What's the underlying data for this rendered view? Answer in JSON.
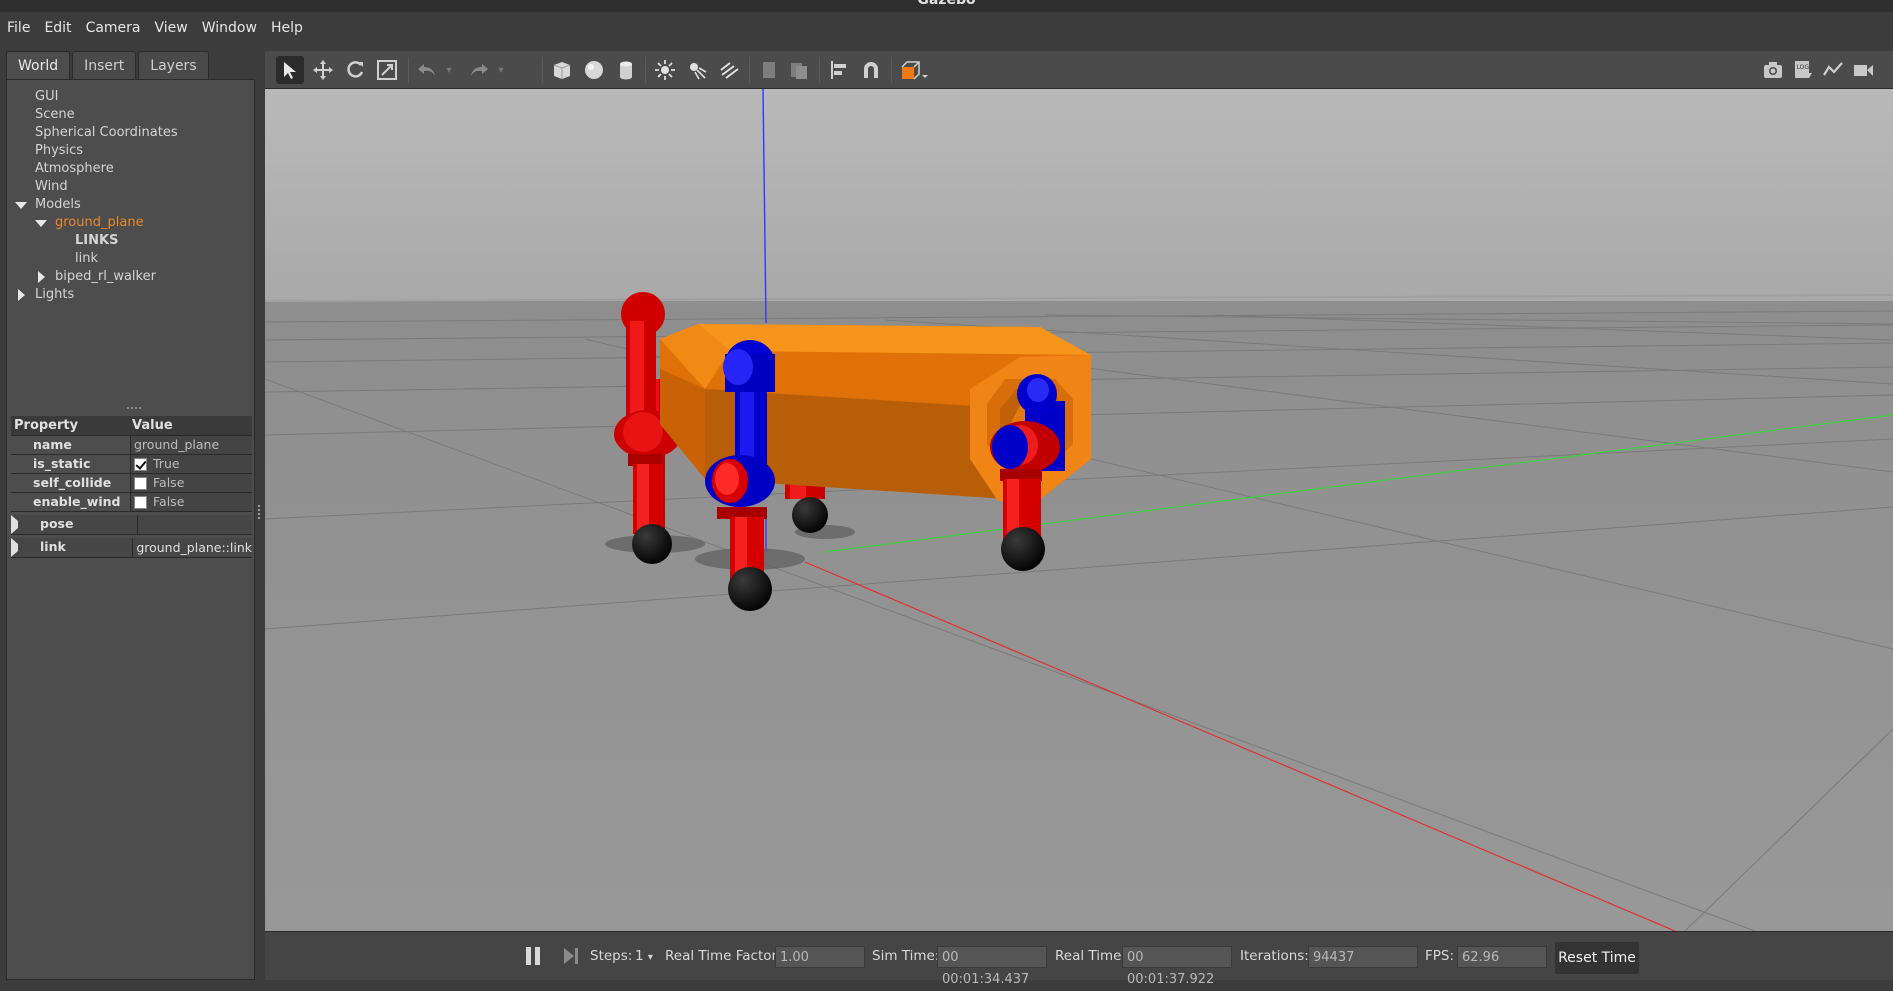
{
  "window": {
    "title": "Gazebo"
  },
  "menu": [
    "File",
    "Edit",
    "Camera",
    "View",
    "Window",
    "Help"
  ],
  "left_panel": {
    "tabs": [
      {
        "label": "World",
        "active": true
      },
      {
        "label": "Insert",
        "active": false
      },
      {
        "label": "Layers",
        "active": false
      }
    ],
    "tree": {
      "gui": "GUI",
      "scene": "Scene",
      "spherical": "Spherical Coordinates",
      "physics": "Physics",
      "atmosphere": "Atmosphere",
      "wind": "Wind",
      "models": "Models",
      "ground_plane": "ground_plane",
      "links_header": "LINKS",
      "link": "link",
      "biped": "biped_rl_walker",
      "lights": "Lights"
    },
    "properties": {
      "header_property": "Property",
      "header_value": "Value",
      "name_label": "name",
      "name_value": "ground_plane",
      "is_static_label": "is_static",
      "is_static_value": "True",
      "self_collide_label": "self_collide",
      "self_collide_value": "False",
      "enable_wind_label": "enable_wind",
      "enable_wind_value": "False",
      "pose_label": "pose",
      "link_label": "link",
      "link_value": "ground_plane::link"
    }
  },
  "toolbar": {
    "icons": [
      "select-icon",
      "translate-icon",
      "rotate-icon",
      "scale-icon",
      "undo-icon",
      "redo-icon",
      "box-icon",
      "sphere-icon",
      "cylinder-icon",
      "point-light-icon",
      "spot-light-icon",
      "directional-light-icon",
      "copy-icon",
      "paste-icon",
      "align-icon",
      "snap-icon",
      "view-angle-icon",
      "screenshot-icon",
      "log-icon",
      "plot-icon",
      "video-icon"
    ]
  },
  "bottom_bar": {
    "steps_label": "Steps:",
    "steps_value": "1",
    "rtf_label": "Real Time Factor:",
    "rtf_value": "1.00",
    "sim_time_label": "Sim Time:",
    "sim_time_value": "00 00:01:34.437",
    "real_time_label": "Real Time:",
    "real_time_value": "00 00:01:37.922",
    "iterations_label": "Iterations:",
    "iterations_value": "94437",
    "fps_label": "FPS:",
    "fps_value": "62.96",
    "reset_label": "Reset Time"
  },
  "colors": {
    "selected_item": "#e8882e",
    "robot_body": "#f08010",
    "robot_red": "#dd0000",
    "robot_blue": "#0000dd"
  }
}
